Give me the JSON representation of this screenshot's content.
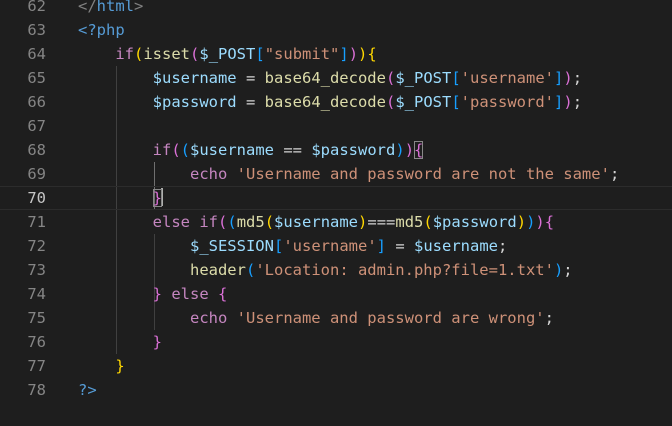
{
  "editor": {
    "current_line": "70",
    "lines": [
      {
        "num": "62",
        "tokens": [
          {
            "t": "</",
            "c": "#808080"
          },
          {
            "t": "html",
            "c": "#569cd6"
          },
          {
            "t": ">",
            "c": "#808080"
          }
        ]
      },
      {
        "num": "63",
        "tokens": [
          {
            "t": "<?php",
            "c": "#569cd6"
          }
        ]
      },
      {
        "num": "64",
        "tokens": [
          {
            "t": "    "
          },
          {
            "t": "if",
            "c": "#c586c0"
          },
          {
            "t": "(",
            "c": "#ffd700"
          },
          {
            "t": "isset",
            "c": "#dcdcaa"
          },
          {
            "t": "(",
            "c": "#da70d6"
          },
          {
            "t": "$_POST",
            "c": "#9cdcfe"
          },
          {
            "t": "[",
            "c": "#179fff"
          },
          {
            "t": "\"submit\"",
            "c": "#ce9178"
          },
          {
            "t": "]",
            "c": "#179fff"
          },
          {
            "t": ")",
            "c": "#da70d6"
          },
          {
            "t": ")",
            "c": "#ffd700"
          },
          {
            "t": "{",
            "c": "#ffd700"
          }
        ]
      },
      {
        "num": "65",
        "tokens": [
          {
            "t": "        "
          },
          {
            "t": "$username",
            "c": "#9cdcfe"
          },
          {
            "t": " = ",
            "c": "#d4d4d4"
          },
          {
            "t": "base64_decode",
            "c": "#dcdcaa"
          },
          {
            "t": "(",
            "c": "#da70d6"
          },
          {
            "t": "$_POST",
            "c": "#9cdcfe"
          },
          {
            "t": "[",
            "c": "#179fff"
          },
          {
            "t": "'username'",
            "c": "#ce9178"
          },
          {
            "t": "]",
            "c": "#179fff"
          },
          {
            "t": ")",
            "c": "#da70d6"
          },
          {
            "t": ";",
            "c": "#d4d4d4"
          }
        ]
      },
      {
        "num": "66",
        "tokens": [
          {
            "t": "        "
          },
          {
            "t": "$password",
            "c": "#9cdcfe"
          },
          {
            "t": " = ",
            "c": "#d4d4d4"
          },
          {
            "t": "base64_decode",
            "c": "#dcdcaa"
          },
          {
            "t": "(",
            "c": "#da70d6"
          },
          {
            "t": "$_POST",
            "c": "#9cdcfe"
          },
          {
            "t": "[",
            "c": "#179fff"
          },
          {
            "t": "'password'",
            "c": "#ce9178"
          },
          {
            "t": "]",
            "c": "#179fff"
          },
          {
            "t": ")",
            "c": "#da70d6"
          },
          {
            "t": ";",
            "c": "#d4d4d4"
          }
        ]
      },
      {
        "num": "67",
        "tokens": []
      },
      {
        "num": "68",
        "tokens": [
          {
            "t": "        "
          },
          {
            "t": "if",
            "c": "#c586c0"
          },
          {
            "t": "(",
            "c": "#da70d6"
          },
          {
            "t": "(",
            "c": "#179fff"
          },
          {
            "t": "$username",
            "c": "#9cdcfe"
          },
          {
            "t": " == ",
            "c": "#d4d4d4"
          },
          {
            "t": "$password",
            "c": "#9cdcfe"
          },
          {
            "t": ")",
            "c": "#179fff"
          },
          {
            "t": ")",
            "c": "#da70d6"
          },
          {
            "t": "{",
            "c": "#da70d6",
            "box": true
          }
        ]
      },
      {
        "num": "69",
        "tokens": [
          {
            "t": "            "
          },
          {
            "t": "echo",
            "c": "#c586c0"
          },
          {
            "t": " "
          },
          {
            "t": "'Username and password are not the same'",
            "c": "#ce9178"
          },
          {
            "t": ";",
            "c": "#d4d4d4"
          }
        ]
      },
      {
        "num": "70",
        "tokens": [
          {
            "t": "        "
          },
          {
            "t": "}",
            "c": "#da70d6",
            "box": true
          },
          {
            "cursor": true
          }
        ]
      },
      {
        "num": "71",
        "tokens": [
          {
            "t": "        "
          },
          {
            "t": "else",
            "c": "#c586c0"
          },
          {
            "t": " "
          },
          {
            "t": "if",
            "c": "#c586c0"
          },
          {
            "t": "(",
            "c": "#da70d6"
          },
          {
            "t": "(",
            "c": "#179fff"
          },
          {
            "t": "md5",
            "c": "#dcdcaa"
          },
          {
            "t": "(",
            "c": "#ffd700"
          },
          {
            "t": "$username",
            "c": "#9cdcfe"
          },
          {
            "t": ")",
            "c": "#ffd700"
          },
          {
            "t": "===",
            "c": "#d4d4d4"
          },
          {
            "t": "md5",
            "c": "#dcdcaa"
          },
          {
            "t": "(",
            "c": "#ffd700"
          },
          {
            "t": "$password",
            "c": "#9cdcfe"
          },
          {
            "t": ")",
            "c": "#ffd700"
          },
          {
            "t": ")",
            "c": "#179fff"
          },
          {
            "t": ")",
            "c": "#da70d6"
          },
          {
            "t": "{",
            "c": "#da70d6"
          }
        ]
      },
      {
        "num": "72",
        "tokens": [
          {
            "t": "            "
          },
          {
            "t": "$_SESSION",
            "c": "#9cdcfe"
          },
          {
            "t": "[",
            "c": "#179fff"
          },
          {
            "t": "'username'",
            "c": "#ce9178"
          },
          {
            "t": "]",
            "c": "#179fff"
          },
          {
            "t": " = ",
            "c": "#d4d4d4"
          },
          {
            "t": "$username",
            "c": "#9cdcfe"
          },
          {
            "t": ";",
            "c": "#d4d4d4"
          }
        ]
      },
      {
        "num": "73",
        "tokens": [
          {
            "t": "            "
          },
          {
            "t": "header",
            "c": "#dcdcaa"
          },
          {
            "t": "(",
            "c": "#179fff"
          },
          {
            "t": "'Location: admin.php?file=1.txt'",
            "c": "#ce9178"
          },
          {
            "t": ")",
            "c": "#179fff"
          },
          {
            "t": ";",
            "c": "#d4d4d4"
          }
        ]
      },
      {
        "num": "74",
        "tokens": [
          {
            "t": "        "
          },
          {
            "t": "}",
            "c": "#da70d6"
          },
          {
            "t": " "
          },
          {
            "t": "else",
            "c": "#c586c0"
          },
          {
            "t": " "
          },
          {
            "t": "{",
            "c": "#da70d6"
          }
        ]
      },
      {
        "num": "75",
        "tokens": [
          {
            "t": "            "
          },
          {
            "t": "echo",
            "c": "#c586c0"
          },
          {
            "t": " "
          },
          {
            "t": "'Username and password are wrong'",
            "c": "#ce9178"
          },
          {
            "t": ";",
            "c": "#d4d4d4"
          }
        ]
      },
      {
        "num": "76",
        "tokens": [
          {
            "t": "        "
          },
          {
            "t": "}",
            "c": "#da70d6"
          }
        ]
      },
      {
        "num": "77",
        "tokens": [
          {
            "t": "    "
          },
          {
            "t": "}",
            "c": "#ffd700"
          }
        ]
      },
      {
        "num": "78",
        "tokens": [
          {
            "t": "?>",
            "c": "#569cd6"
          }
        ]
      }
    ]
  }
}
